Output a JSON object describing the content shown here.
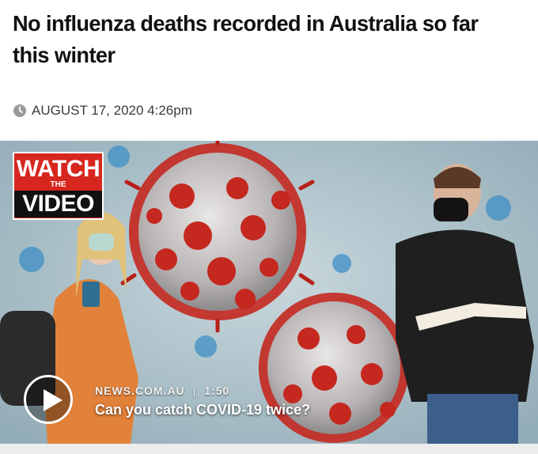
{
  "article": {
    "headline": "No influenza deaths recorded in Australia so far this winter",
    "date": "AUGUST 17, 2020 4:26pm"
  },
  "video": {
    "badge_line1": "WATCH",
    "badge_line2": "THE",
    "badge_line3": "VIDEO",
    "source": "NEWS.COM.AU",
    "separator": "|",
    "duration": "1:50",
    "title": "Can you catch COVID-19 twice?"
  },
  "icons": {
    "clock": "clock-icon",
    "play": "play-icon"
  },
  "colors": {
    "badge_red": "#d7261e",
    "virus_red": "#c4281f"
  }
}
